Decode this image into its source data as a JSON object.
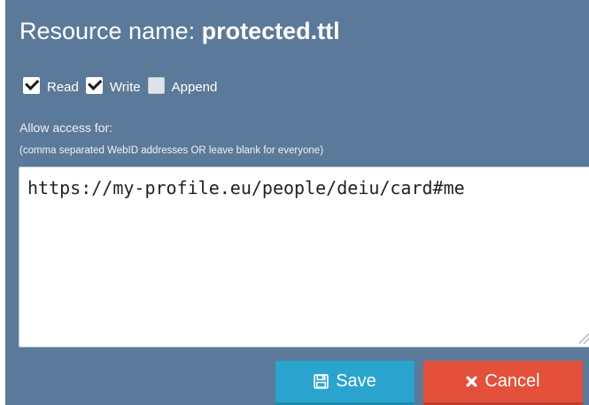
{
  "dialog": {
    "title_prefix": "Resource name:",
    "resource_name": "protected.ttl"
  },
  "permissions": [
    {
      "label": "Read",
      "checked": true
    },
    {
      "label": "Write",
      "checked": true
    },
    {
      "label": "Append",
      "checked": false
    }
  ],
  "access": {
    "label": "Allow access for:",
    "hint": "(comma separated WebID addresses OR leave blank for everyone)",
    "value": "https://my-profile.eu/people/deiu/card#me"
  },
  "buttons": {
    "save_label": "Save",
    "save_icon": "floppy-disk-icon",
    "cancel_label": "Cancel",
    "cancel_icon": "close-icon"
  },
  "colors": {
    "dialog_bg": "#5b7a99",
    "save_bg": "#2aa3cf",
    "cancel_bg": "#e3503b"
  }
}
